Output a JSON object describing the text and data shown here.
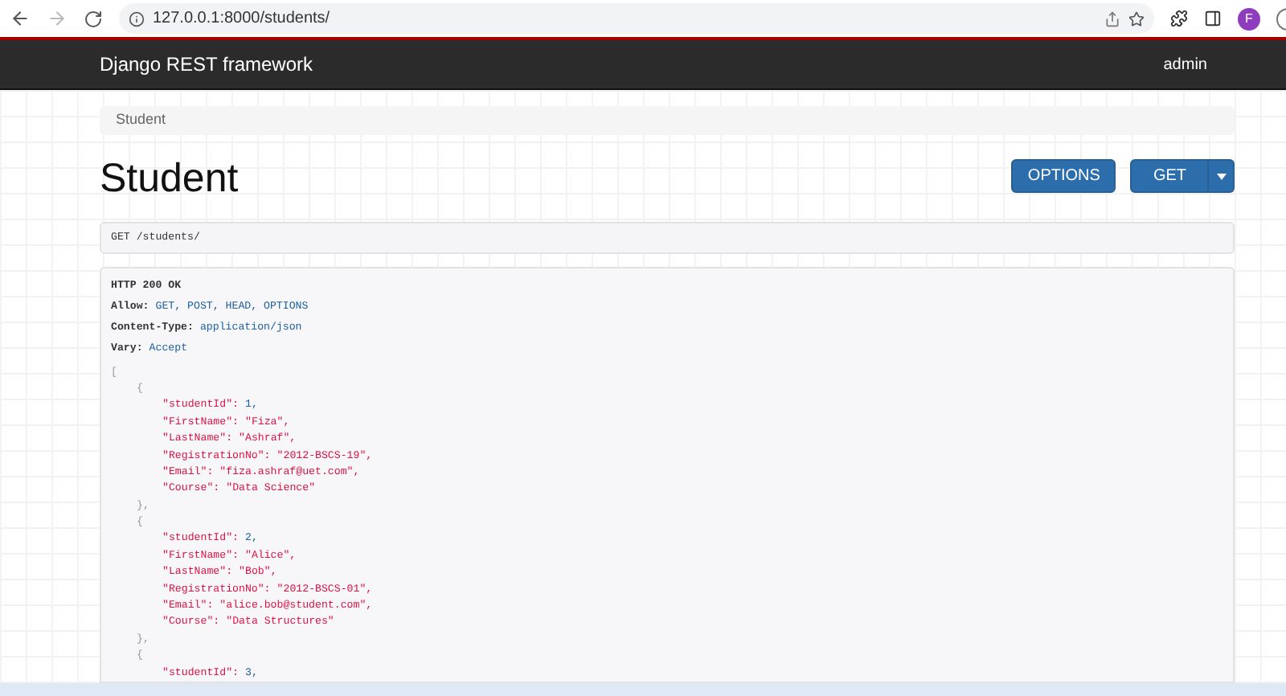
{
  "browser": {
    "url": "127.0.0.1:8000/students/",
    "profile_initial": "F"
  },
  "navbar": {
    "brand": "Django REST framework",
    "user": "admin"
  },
  "breadcrumb": [
    "Student"
  ],
  "page": {
    "title": "Student",
    "buttons": [
      {
        "label": "OPTIONS",
        "kind": "plain"
      },
      {
        "label": "GET",
        "kind": "split"
      }
    ]
  },
  "request": {
    "text": "GET /students/"
  },
  "response": {
    "status": "HTTP 200 OK",
    "headers": [
      {
        "name": "Allow:",
        "value": "GET, POST, HEAD, OPTIONS"
      },
      {
        "name": "Content-Type:",
        "value": "application/json"
      },
      {
        "name": "Vary:",
        "value": "Accept"
      }
    ],
    "open": "[",
    "items": [
      {
        "open": "{",
        "fields": [
          {
            "key": "\"studentId\":",
            "value": "1,",
            "kind": "number"
          },
          {
            "key": "\"FirstName\":",
            "value": "\"Fiza\",",
            "kind": "string"
          },
          {
            "key": "\"LastName\":",
            "value": "\"Ashraf\",",
            "kind": "string"
          },
          {
            "key": "\"RegistrationNo\":",
            "value": "\"2012-BSCS-19\",",
            "kind": "string"
          },
          {
            "key": "\"Email\":",
            "value": "\"fiza.ashraf@uet.com\",",
            "kind": "string"
          },
          {
            "key": "\"Course\":",
            "value": "\"Data Science\"",
            "kind": "string"
          }
        ],
        "close": "},"
      },
      {
        "open": "{",
        "fields": [
          {
            "key": "\"studentId\":",
            "value": "2,",
            "kind": "number"
          },
          {
            "key": "\"FirstName\":",
            "value": "\"Alice\",",
            "kind": "string"
          },
          {
            "key": "\"LastName\":",
            "value": "\"Bob\",",
            "kind": "string"
          },
          {
            "key": "\"RegistrationNo\":",
            "value": "\"2012-BSCS-01\",",
            "kind": "string"
          },
          {
            "key": "\"Email\":",
            "value": "\"alice.bob@student.com\",",
            "kind": "string"
          },
          {
            "key": "\"Course\":",
            "value": "\"Data Structures\"",
            "kind": "string"
          }
        ],
        "close": "},"
      },
      {
        "open": "{",
        "fields": [
          {
            "key": "\"studentId\":",
            "value": "3,",
            "kind": "number"
          }
        ]
      }
    ]
  }
}
